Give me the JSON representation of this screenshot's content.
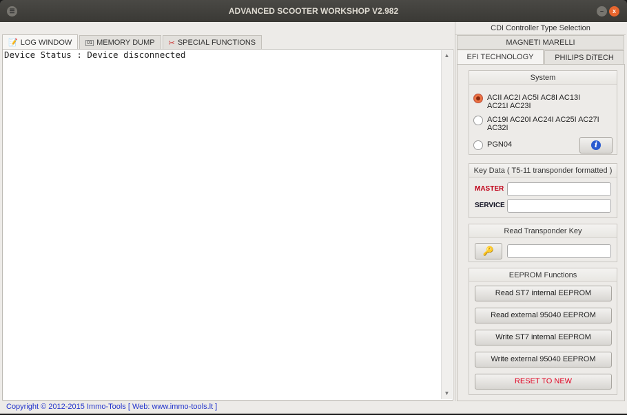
{
  "window": {
    "title": "ADVANCED SCOOTER WORKSHOP  V2.982"
  },
  "tabs": [
    {
      "label": "LOG WINDOW"
    },
    {
      "label": "MEMORY DUMP"
    },
    {
      "label": "SPECIAL FUNCTIONS"
    }
  ],
  "log": {
    "text": "Device Status : Device disconnected"
  },
  "status": "Copyright © 2012-2015 Immo-Tools [ Web: www.immo-tools.lt ]",
  "right": {
    "header": "CDI Controller Type Selection",
    "tabs": [
      "MAGNETI MARELLI",
      "EFI TECHNOLOGY",
      "PHILIPS DiTECH"
    ],
    "system": {
      "title": "System",
      "options": [
        {
          "line1": "ACII  AC2I  AC5I  AC8I  AC13I",
          "line2": "AC21I  AC23I",
          "selected": true
        },
        {
          "line1": "AC19I  AC20I  AC24I  AC25I  AC27I",
          "line2": "AC32I",
          "selected": false
        },
        {
          "line1": "PGN04",
          "selected": false
        }
      ]
    },
    "keydata": {
      "title": "Key Data ( T5-11 transponder formatted )",
      "master": "MASTER",
      "service": "SERVICE",
      "master_value": "",
      "service_value": ""
    },
    "transponder": {
      "title": "Read Transponder Key",
      "value": ""
    },
    "eeprom": {
      "title": "EEPROM Functions",
      "buttons": [
        "Read ST7 internal EEPROM",
        "Read external 95040 EEPROM",
        "Write ST7 internal EEPROM",
        "Write external 95040 EEPROM",
        "RESET TO NEW"
      ]
    }
  }
}
